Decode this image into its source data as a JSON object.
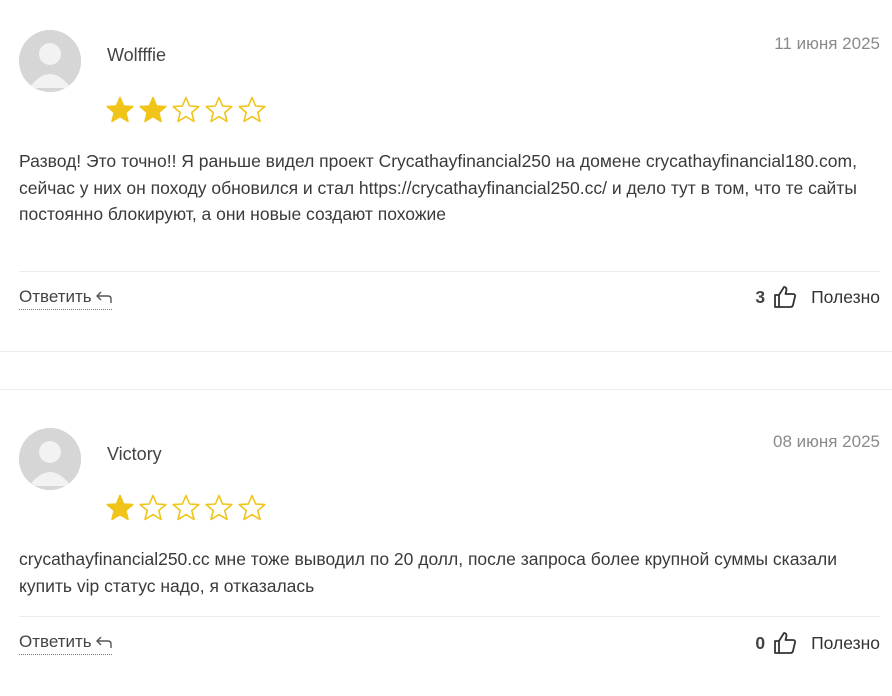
{
  "colors": {
    "star_filled": "#f0c419",
    "star_empty_outline": "#f0c419",
    "divider": "#ececec"
  },
  "reviews": [
    {
      "author": "Wolfffie",
      "date": "11 июня 2025",
      "rating": 2,
      "max_rating": 5,
      "text": "Развод! Это точно!! Я раньше видел проект Crycathayfinancial250 на домене crycathayfinancial180.com, сейчас у них он походу обновился и стал https://crycathayfinancial250.cc/ и дело тут в том, что те сайты постоянно блокируют, а они новые создают похожие",
      "reply_label": "Ответить",
      "helpful_count": "3",
      "helpful_label": "Полезно"
    },
    {
      "author": "Victory",
      "date": "08 июня 2025",
      "rating": 1,
      "max_rating": 5,
      "text": "crycathayfinancial250.cc мне тоже выводил по 20 долл, после запроса более крупной суммы сказали купить vip статус надо, я отказалась",
      "reply_label": "Ответить",
      "helpful_count": "0",
      "helpful_label": "Полезно"
    }
  ]
}
